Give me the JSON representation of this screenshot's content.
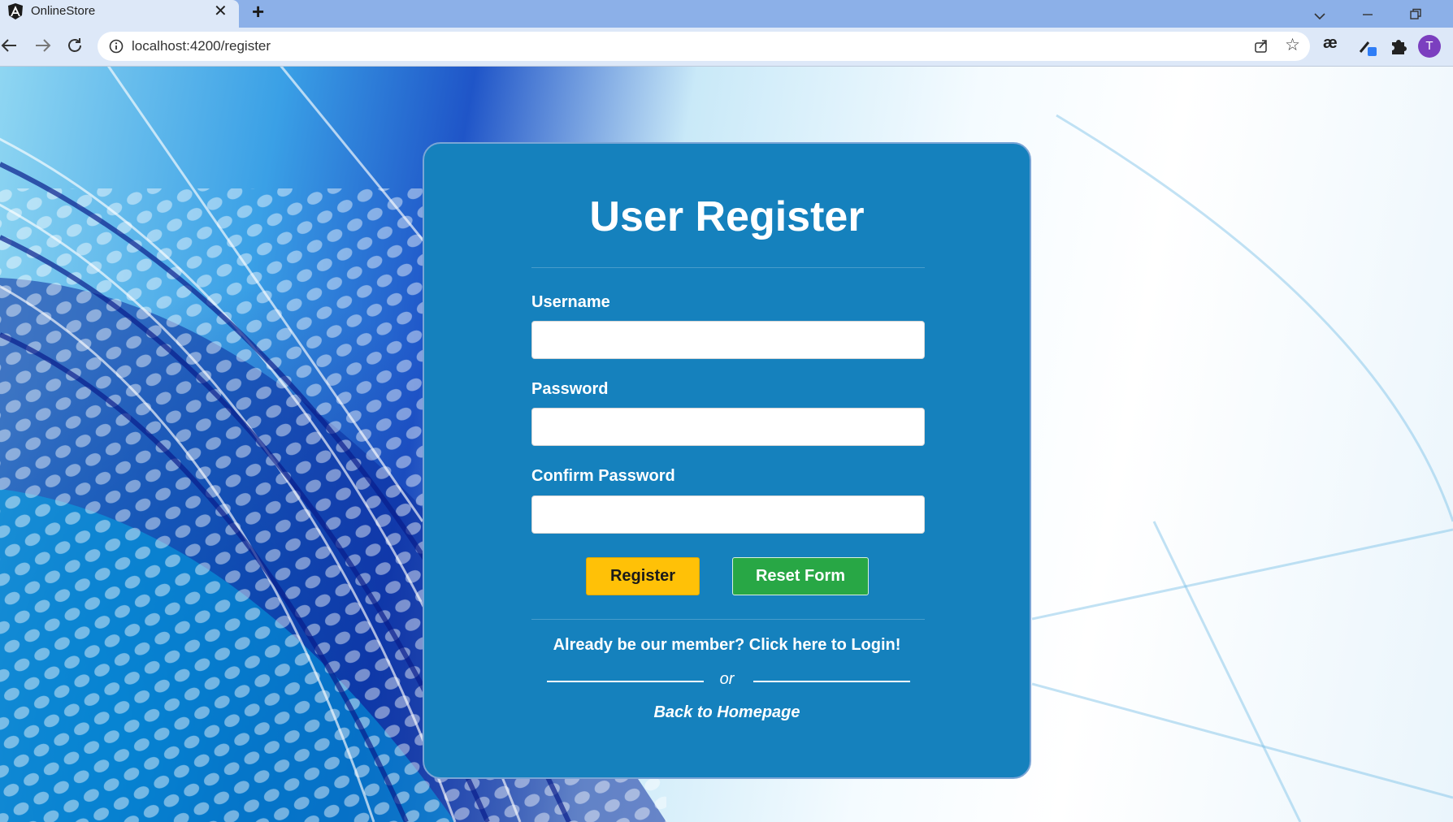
{
  "browser": {
    "tab_title": "OnlineStore",
    "url": "localhost:4200/register",
    "profile_initial": "T",
    "extension_label": "æ",
    "icons": [
      "angular-favicon",
      "close-icon",
      "plus-icon",
      "chevron-down-icon",
      "minimize-icon",
      "restore-icon",
      "back-icon",
      "forward-icon",
      "reload-icon",
      "info-icon",
      "share-icon",
      "star-icon",
      "extension-icon",
      "puzzle-icon"
    ]
  },
  "form": {
    "title": "User Register",
    "username_label": "Username",
    "username_value": "",
    "password_label": "Password",
    "password_value": "",
    "confirm_label": "Confirm Password",
    "confirm_value": "",
    "register_button": "Register",
    "reset_button": "Reset Form",
    "login_link": "Already be our member? Click here to Login!",
    "or_text": "or",
    "home_link": "Back to Homepage"
  },
  "colors": {
    "card": "#1581bd",
    "register": "#ffc107",
    "reset": "#28a745"
  }
}
